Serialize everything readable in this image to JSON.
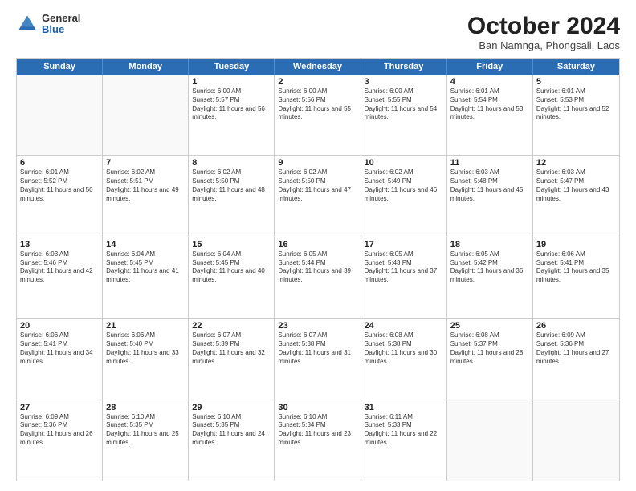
{
  "logo": {
    "general": "General",
    "blue": "Blue"
  },
  "title": "October 2024",
  "location": "Ban Namnga, Phongsali, Laos",
  "header_days": [
    "Sunday",
    "Monday",
    "Tuesday",
    "Wednesday",
    "Thursday",
    "Friday",
    "Saturday"
  ],
  "weeks": [
    [
      {
        "day": "",
        "sunrise": "",
        "sunset": "",
        "daylight": ""
      },
      {
        "day": "",
        "sunrise": "",
        "sunset": "",
        "daylight": ""
      },
      {
        "day": "1",
        "sunrise": "Sunrise: 6:00 AM",
        "sunset": "Sunset: 5:57 PM",
        "daylight": "Daylight: 11 hours and 56 minutes."
      },
      {
        "day": "2",
        "sunrise": "Sunrise: 6:00 AM",
        "sunset": "Sunset: 5:56 PM",
        "daylight": "Daylight: 11 hours and 55 minutes."
      },
      {
        "day": "3",
        "sunrise": "Sunrise: 6:00 AM",
        "sunset": "Sunset: 5:55 PM",
        "daylight": "Daylight: 11 hours and 54 minutes."
      },
      {
        "day": "4",
        "sunrise": "Sunrise: 6:01 AM",
        "sunset": "Sunset: 5:54 PM",
        "daylight": "Daylight: 11 hours and 53 minutes."
      },
      {
        "day": "5",
        "sunrise": "Sunrise: 6:01 AM",
        "sunset": "Sunset: 5:53 PM",
        "daylight": "Daylight: 11 hours and 52 minutes."
      }
    ],
    [
      {
        "day": "6",
        "sunrise": "Sunrise: 6:01 AM",
        "sunset": "Sunset: 5:52 PM",
        "daylight": "Daylight: 11 hours and 50 minutes."
      },
      {
        "day": "7",
        "sunrise": "Sunrise: 6:02 AM",
        "sunset": "Sunset: 5:51 PM",
        "daylight": "Daylight: 11 hours and 49 minutes."
      },
      {
        "day": "8",
        "sunrise": "Sunrise: 6:02 AM",
        "sunset": "Sunset: 5:50 PM",
        "daylight": "Daylight: 11 hours and 48 minutes."
      },
      {
        "day": "9",
        "sunrise": "Sunrise: 6:02 AM",
        "sunset": "Sunset: 5:50 PM",
        "daylight": "Daylight: 11 hours and 47 minutes."
      },
      {
        "day": "10",
        "sunrise": "Sunrise: 6:02 AM",
        "sunset": "Sunset: 5:49 PM",
        "daylight": "Daylight: 11 hours and 46 minutes."
      },
      {
        "day": "11",
        "sunrise": "Sunrise: 6:03 AM",
        "sunset": "Sunset: 5:48 PM",
        "daylight": "Daylight: 11 hours and 45 minutes."
      },
      {
        "day": "12",
        "sunrise": "Sunrise: 6:03 AM",
        "sunset": "Sunset: 5:47 PM",
        "daylight": "Daylight: 11 hours and 43 minutes."
      }
    ],
    [
      {
        "day": "13",
        "sunrise": "Sunrise: 6:03 AM",
        "sunset": "Sunset: 5:46 PM",
        "daylight": "Daylight: 11 hours and 42 minutes."
      },
      {
        "day": "14",
        "sunrise": "Sunrise: 6:04 AM",
        "sunset": "Sunset: 5:45 PM",
        "daylight": "Daylight: 11 hours and 41 minutes."
      },
      {
        "day": "15",
        "sunrise": "Sunrise: 6:04 AM",
        "sunset": "Sunset: 5:45 PM",
        "daylight": "Daylight: 11 hours and 40 minutes."
      },
      {
        "day": "16",
        "sunrise": "Sunrise: 6:05 AM",
        "sunset": "Sunset: 5:44 PM",
        "daylight": "Daylight: 11 hours and 39 minutes."
      },
      {
        "day": "17",
        "sunrise": "Sunrise: 6:05 AM",
        "sunset": "Sunset: 5:43 PM",
        "daylight": "Daylight: 11 hours and 37 minutes."
      },
      {
        "day": "18",
        "sunrise": "Sunrise: 6:05 AM",
        "sunset": "Sunset: 5:42 PM",
        "daylight": "Daylight: 11 hours and 36 minutes."
      },
      {
        "day": "19",
        "sunrise": "Sunrise: 6:06 AM",
        "sunset": "Sunset: 5:41 PM",
        "daylight": "Daylight: 11 hours and 35 minutes."
      }
    ],
    [
      {
        "day": "20",
        "sunrise": "Sunrise: 6:06 AM",
        "sunset": "Sunset: 5:41 PM",
        "daylight": "Daylight: 11 hours and 34 minutes."
      },
      {
        "day": "21",
        "sunrise": "Sunrise: 6:06 AM",
        "sunset": "Sunset: 5:40 PM",
        "daylight": "Daylight: 11 hours and 33 minutes."
      },
      {
        "day": "22",
        "sunrise": "Sunrise: 6:07 AM",
        "sunset": "Sunset: 5:39 PM",
        "daylight": "Daylight: 11 hours and 32 minutes."
      },
      {
        "day": "23",
        "sunrise": "Sunrise: 6:07 AM",
        "sunset": "Sunset: 5:38 PM",
        "daylight": "Daylight: 11 hours and 31 minutes."
      },
      {
        "day": "24",
        "sunrise": "Sunrise: 6:08 AM",
        "sunset": "Sunset: 5:38 PM",
        "daylight": "Daylight: 11 hours and 30 minutes."
      },
      {
        "day": "25",
        "sunrise": "Sunrise: 6:08 AM",
        "sunset": "Sunset: 5:37 PM",
        "daylight": "Daylight: 11 hours and 28 minutes."
      },
      {
        "day": "26",
        "sunrise": "Sunrise: 6:09 AM",
        "sunset": "Sunset: 5:36 PM",
        "daylight": "Daylight: 11 hours and 27 minutes."
      }
    ],
    [
      {
        "day": "27",
        "sunrise": "Sunrise: 6:09 AM",
        "sunset": "Sunset: 5:36 PM",
        "daylight": "Daylight: 11 hours and 26 minutes."
      },
      {
        "day": "28",
        "sunrise": "Sunrise: 6:10 AM",
        "sunset": "Sunset: 5:35 PM",
        "daylight": "Daylight: 11 hours and 25 minutes."
      },
      {
        "day": "29",
        "sunrise": "Sunrise: 6:10 AM",
        "sunset": "Sunset: 5:35 PM",
        "daylight": "Daylight: 11 hours and 24 minutes."
      },
      {
        "day": "30",
        "sunrise": "Sunrise: 6:10 AM",
        "sunset": "Sunset: 5:34 PM",
        "daylight": "Daylight: 11 hours and 23 minutes."
      },
      {
        "day": "31",
        "sunrise": "Sunrise: 6:11 AM",
        "sunset": "Sunset: 5:33 PM",
        "daylight": "Daylight: 11 hours and 22 minutes."
      },
      {
        "day": "",
        "sunrise": "",
        "sunset": "",
        "daylight": ""
      },
      {
        "day": "",
        "sunrise": "",
        "sunset": "",
        "daylight": ""
      }
    ]
  ]
}
